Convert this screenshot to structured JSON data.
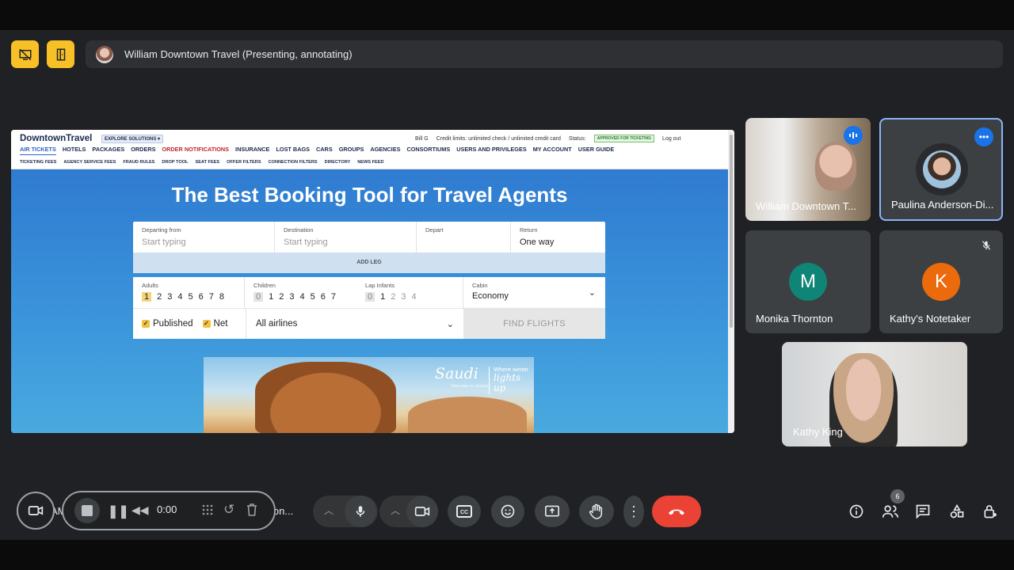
{
  "presenting_banner": {
    "text": "William Downtown Travel (Presenting, annotating)"
  },
  "shared_screen": {
    "logo": "DowntownTravel",
    "explore": "EXPLORE SOLUTIONS ▾",
    "user": "Bill G",
    "credit": "Credit limits: unlimited check / unlimited credit card",
    "status_label": "Status:",
    "status_badge": "APPROVED FOR TICKETING",
    "logout": "Log out",
    "nav": [
      "AIR TICKETS",
      "HOTELS",
      "PACKAGES",
      "ORDERS",
      "ORDER NOTIFICATIONS",
      "INSURANCE",
      "LOST BAGS",
      "CARS",
      "GROUPS",
      "AGENCIES",
      "CONSORTIUMS",
      "USERS AND PRIVILEGES",
      "MY ACCOUNT",
      "USER GUIDE"
    ],
    "subnav": [
      "TICKETING FEES",
      "AGENCY SERVICE FEES",
      "FRAUD RULES",
      "DROP TOOL",
      "SEAT FEES",
      "OFFER FILTERS",
      "CONNECTION FILTERS",
      "DIRECTORY",
      "NEWS FEED"
    ],
    "hero_title": "The Best Booking Tool for Travel Agents",
    "form": {
      "departing_label": "Departing from",
      "departing_placeholder": "Start typing",
      "destination_label": "Destination",
      "destination_placeholder": "Start typing",
      "depart_label": "Depart",
      "return_label": "Return",
      "return_value": "One way",
      "add_leg": "ADD LEG",
      "adults_label": "Adults",
      "adults": [
        "1",
        "2",
        "3",
        "4",
        "5",
        "6",
        "7",
        "8"
      ],
      "children_label": "Children",
      "children": [
        "0",
        "1",
        "2",
        "3",
        "4",
        "5",
        "6",
        "7"
      ],
      "infants_label": "Lap Infants",
      "infants": [
        "0",
        "1",
        "2",
        "3",
        "4"
      ],
      "cabin_label": "Cabin",
      "cabin_value": "Economy",
      "published": "Published",
      "net": "Net",
      "airlines": "All airlines",
      "find": "FIND FLIGHTS"
    },
    "banner": {
      "brand": "Saudi",
      "brand_sub": "Welcome to Arabia",
      "tag_line1": "Where winter",
      "tag_line2": "lights up"
    }
  },
  "participants": [
    {
      "name": "William Downtown T..."
    },
    {
      "name": "Paulina Anderson-Di..."
    },
    {
      "name": "Monika Thornton",
      "initial": "M",
      "color": "#0f8577"
    },
    {
      "name": "Kathy's Notetaker",
      "initial": "K",
      "color": "#ea6a0c"
    },
    {
      "name": "Kathy King"
    }
  ],
  "controls": {
    "timer": "0:00",
    "clock_fragment": "1",
    "am_fragment": "AM",
    "meeting_fragment": "ion...",
    "participant_count": "6"
  }
}
